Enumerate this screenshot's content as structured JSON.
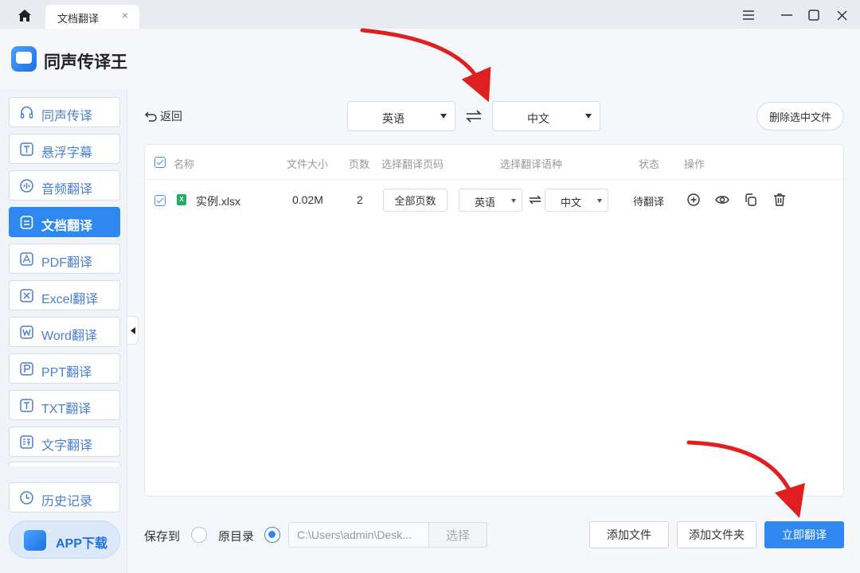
{
  "tab": {
    "label": "文档翻译",
    "close": "×"
  },
  "app": {
    "title": "同声传译王"
  },
  "sidebar": {
    "items": [
      {
        "label": "同声传译",
        "icon": "headphones-icon"
      },
      {
        "label": "悬浮字幕",
        "icon": "subtitle-icon"
      },
      {
        "label": "音频翻译",
        "icon": "audio-wave-icon"
      },
      {
        "label": "文档翻译",
        "icon": "document-icon",
        "active": true
      },
      {
        "label": "PDF翻译",
        "icon": "pdf-icon"
      },
      {
        "label": "Excel翻译",
        "icon": "excel-icon"
      },
      {
        "label": "Word翻译",
        "icon": "word-icon"
      },
      {
        "label": "PPT翻译",
        "icon": "ppt-icon"
      },
      {
        "label": "TXT翻译",
        "icon": "txt-icon"
      },
      {
        "label": "文字翻译",
        "icon": "text-translate-icon"
      }
    ],
    "history": "历史记录",
    "app_download": "APP下载"
  },
  "toolbar": {
    "back": "返回",
    "source_lang": "英语",
    "target_lang": "中文",
    "delete_selected": "删除选中文件"
  },
  "table": {
    "headers": {
      "name": "名称",
      "size": "文件大小",
      "pages": "页数",
      "select_pages": "选择翻译页码",
      "select_lang": "选择翻译语种",
      "status": "状态",
      "actions": "操作"
    },
    "rows": [
      {
        "name": "实例.xlsx",
        "file_badge": "X",
        "size": "0.02M",
        "pages": "2",
        "page_select": "全部页数",
        "source_lang": "英语",
        "target_lang": "中文",
        "status": "待翻译"
      }
    ]
  },
  "footer": {
    "save_to": "保存到",
    "original_dir": "原目录",
    "path": "C:\\Users\\admin\\Desk...",
    "choose": "选择",
    "add_file": "添加文件",
    "add_folder": "添加文件夹",
    "translate_now": "立即翻译"
  },
  "colors": {
    "accent": "#2f87f0",
    "arrow": "#e02020",
    "excel": "#1fae62"
  }
}
